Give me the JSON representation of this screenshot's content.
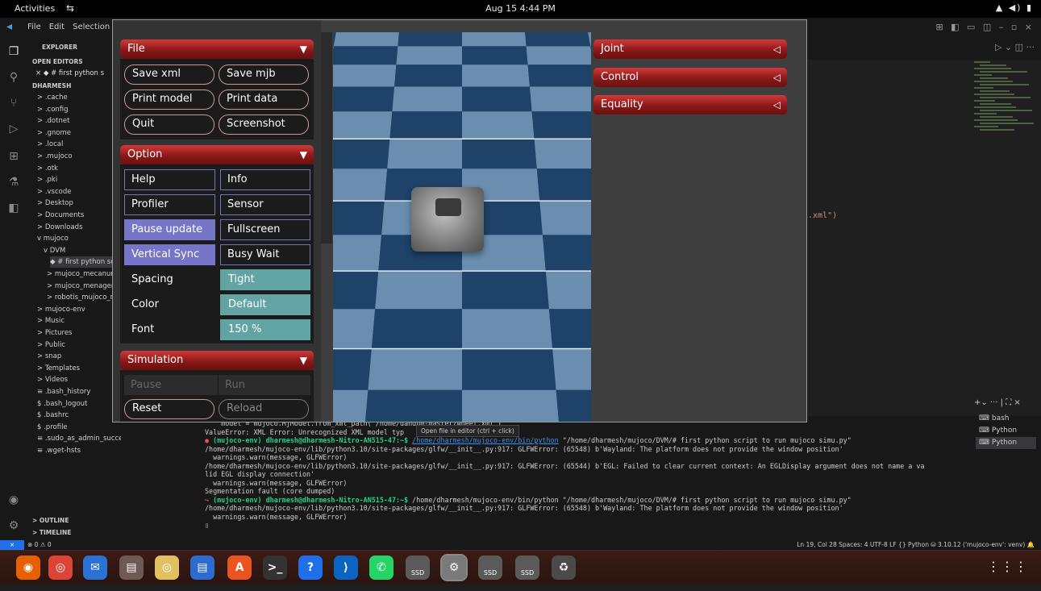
{
  "topbar": {
    "activities": "Activities",
    "clock": "Aug 15  4:44 PM",
    "network_icon": "network-icon",
    "tray": "▲ ◀) ▮"
  },
  "vscode": {
    "menus": [
      "File",
      "Edit",
      "Selection",
      "V"
    ],
    "explorer": {
      "title": "EXPLORER",
      "open_editors": "OPEN EDITORS",
      "open_file": "× ◆ # first python s",
      "root": "DHARMESH",
      "items": [
        "> .cache",
        "> .config",
        "> .dotnet",
        "> .gnome",
        "> .local",
        "> .mujoco",
        "> .otk",
        "> .pki",
        "> .vscode",
        "> Desktop",
        "> Documents",
        "> Downloads",
        "v mujoco",
        "v DVM",
        "◆ # first python scr",
        "> mujoco_mecanum",
        "> mujoco_menagerie",
        "> robotis_mujoco_m",
        "> mujoco-env",
        "> Music",
        "> Pictures",
        "> Public",
        "> snap",
        "> Templates",
        "> Videos",
        "≡ .bash_history",
        "$ .bash_logout",
        "$ .bashrc",
        "$ .profile",
        "≡ .sudo_as_admin_successful",
        "≡ .wget-hsts"
      ],
      "outline": "> OUTLINE",
      "timeline": "> TIMELINE"
    },
    "editor_fragment": "i.xml\")",
    "editor_actions": "▷ ⌄ ◫ ···",
    "terminal": {
      "lines": [
        {
          "t": "    model = mujoco.MjModel.from_xml_path(\"/home/d",
          "u": "",
          "r": "andum-master/wheel.xml\")"
        },
        {
          "t": "ValueError: XML Error: Unrecognized XML model typ",
          "u": "",
          "r": ""
        },
        {
          "p": "(mujoco-env) dharmesh@dharmesh-Nitro-AN515-47:~$ ",
          "u": "/home/dharmesh/mujoco-env/bin/python",
          "r": " \"/home/dharmesh/mujoco/DVM/# first python script to run mujoco simu.py\""
        },
        {
          "t": "/home/dharmesh/mujoco-env/lib/python3.10/site-packages/glfw/__init__.py:917: GLFWError: (65548) b'Wayland: The platform does not provide the window position'",
          "u": "",
          "r": ""
        },
        {
          "t": "  warnings.warn(message, GLFWError)",
          "u": "",
          "r": ""
        },
        {
          "t": "/home/dharmesh/mujoco-env/lib/python3.10/site-packages/glfw/__init__.py:917: GLFWError: (65544) b'EGL: Failed to clear current context: An EGLDisplay argument does not name a va",
          "u": "",
          "r": ""
        },
        {
          "t": "lid EGL display connection'",
          "u": "",
          "r": ""
        },
        {
          "t": "  warnings.warn(message, GLFWError)",
          "u": "",
          "r": ""
        },
        {
          "t": "Segmentation fault (core dumped)",
          "u": "",
          "r": ""
        },
        {
          "p": "(mujoco-env) dharmesh@dharmesh-Nitro-AN515-47:~$ ",
          "u": "",
          "r": "/home/dharmesh/mujoco-env/bin/python \"/home/dharmesh/mujoco/DVM/# first python script to run mujoco simu.py\""
        },
        {
          "t": "/home/dharmesh/mujoco-env/lib/python3.10/site-packages/glfw/__init__.py:917: GLFWError: (65548) b'Wayland: The platform does not provide the window position'",
          "u": "",
          "r": ""
        },
        {
          "t": "  warnings.warn(message, GLFWError)",
          "u": "",
          "r": ""
        },
        {
          "t": "▯",
          "u": "",
          "r": ""
        }
      ],
      "tooltip": "Open file in editor (ctrl + click)",
      "tabs": [
        "bash",
        "Python",
        "Python"
      ],
      "controls": "+⌄ ··· | ⛶ ×"
    },
    "status": {
      "left": "⊗ 0 ⚠ 0",
      "right": "Ln 19, Col 28   Spaces: 4   UTF-8   LF   {} Python   ⛁  3.10.12 ('mujoco-env': venv)   🔔"
    }
  },
  "mujoco": {
    "file": {
      "title": "File",
      "buttons": [
        "Save xml",
        "Save mjb",
        "Print model",
        "Print data",
        "Quit",
        "Screenshot"
      ]
    },
    "option": {
      "title": "Option",
      "toggles": [
        {
          "label": "Help",
          "on": false
        },
        {
          "label": "Info",
          "on": false
        },
        {
          "label": "Profiler",
          "on": false
        },
        {
          "label": "Sensor",
          "on": false
        },
        {
          "label": "Pause update",
          "on": true
        },
        {
          "label": "Fullscreen",
          "on": false
        },
        {
          "label": "Vertical Sync",
          "on": true
        },
        {
          "label": "Busy Wait",
          "on": false
        }
      ],
      "spacing_label": "Spacing",
      "spacing_value": "Tight",
      "color_label": "Color",
      "color_value": "Default",
      "font_label": "Font",
      "font_value": "150 %"
    },
    "simulation": {
      "title": "Simulation",
      "pause": "Pause",
      "run": "Run",
      "reset": "Reset",
      "reload": "Reload"
    },
    "right": [
      {
        "title": "Joint"
      },
      {
        "title": "Control"
      },
      {
        "title": "Equality"
      }
    ],
    "arrow_down": "▼",
    "arrow_left": "◁"
  },
  "dock": {
    "apps": [
      "firefox-icon",
      "chrome-icon",
      "thunderbird-icon",
      "files-icon",
      "rhythmbox-icon",
      "writer-icon",
      "app-center-icon",
      "terminal-icon",
      "help-icon",
      "vscode-icon",
      "whatsapp-icon",
      "ssd-icon",
      "settings-icon",
      "ssd-icon",
      "ssd-icon",
      "trash-icon"
    ],
    "ssd_label": "SSD",
    "grid": "⋮⋮⋮"
  },
  "colors": {
    "section_red": "#b02424",
    "toggle_on": "#7676c8",
    "slot_teal": "#62a3a3",
    "floor_light": "#6a8db0",
    "floor_dark": "#1e4268"
  }
}
